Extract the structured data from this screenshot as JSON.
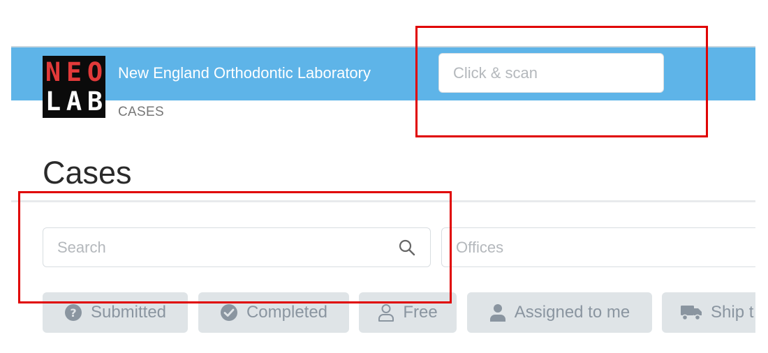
{
  "header": {
    "logo": {
      "line1": "NEO",
      "line2": "LAB"
    },
    "lab_name": "New England Orthodontic Laboratory",
    "breadcrumb": "CASES",
    "scan": {
      "placeholder": "Click & scan",
      "value": ""
    }
  },
  "page": {
    "title": "Cases"
  },
  "filters": {
    "search": {
      "placeholder": "Search",
      "value": ""
    },
    "offices": {
      "placeholder": "Offices"
    }
  },
  "status_chips": [
    {
      "label": "Submitted",
      "icon": "question-circle-icon"
    },
    {
      "label": "Completed",
      "icon": "check-circle-icon"
    },
    {
      "label": "Free",
      "icon": "user-outline-icon"
    },
    {
      "label": "Assigned to me",
      "icon": "user-solid-icon"
    },
    {
      "label": "Ship t",
      "icon": "shipping-truck-icon"
    }
  ],
  "colors": {
    "header_bg": "#5eb4e8",
    "chip_bg": "#dfe4e7",
    "chip_text": "#8a95a0",
    "annotation": "#e00000"
  }
}
